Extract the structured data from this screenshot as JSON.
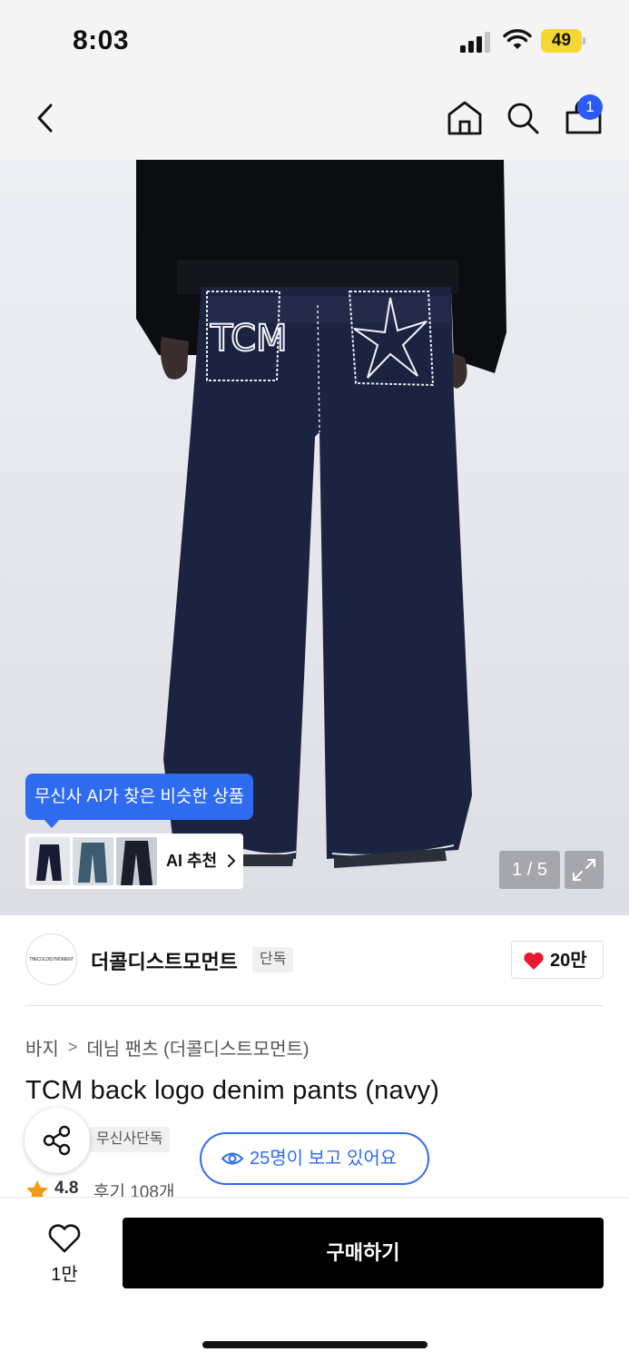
{
  "status_bar": {
    "time": "8:03",
    "battery": "49",
    "icons": [
      "signal-icon",
      "wifi-icon",
      "battery-icon"
    ]
  },
  "nav": {
    "icons": [
      "back-icon",
      "home-icon",
      "search-icon",
      "cart-icon"
    ],
    "cart_badge": "1"
  },
  "product_image": {
    "logo_text": "TCM",
    "counter": "1 / 5",
    "icons": [
      "expand-icon"
    ]
  },
  "ai_recommend": {
    "tooltip": "무신사 AI가 찾은 비슷한 상품",
    "label": "AI 추천",
    "accent_color": "#2f6bef"
  },
  "brand": {
    "logo_text": "THECOLDISTMOMENT",
    "name": "더콜디스트모먼트",
    "tag": "단독",
    "like_count": "20만"
  },
  "breadcrumb": [
    "바지",
    "데님 팬츠 (더콜디스트모먼트)"
  ],
  "product": {
    "title": "TCM back logo denim pants (navy)",
    "exclusive_tag": "무신사단독",
    "viewers": "25명이 보고 있어요",
    "rating": "4.8",
    "reviews": "후기 108개"
  },
  "bottom_bar": {
    "wish_count": "1만",
    "buy_label": "구매하기"
  }
}
